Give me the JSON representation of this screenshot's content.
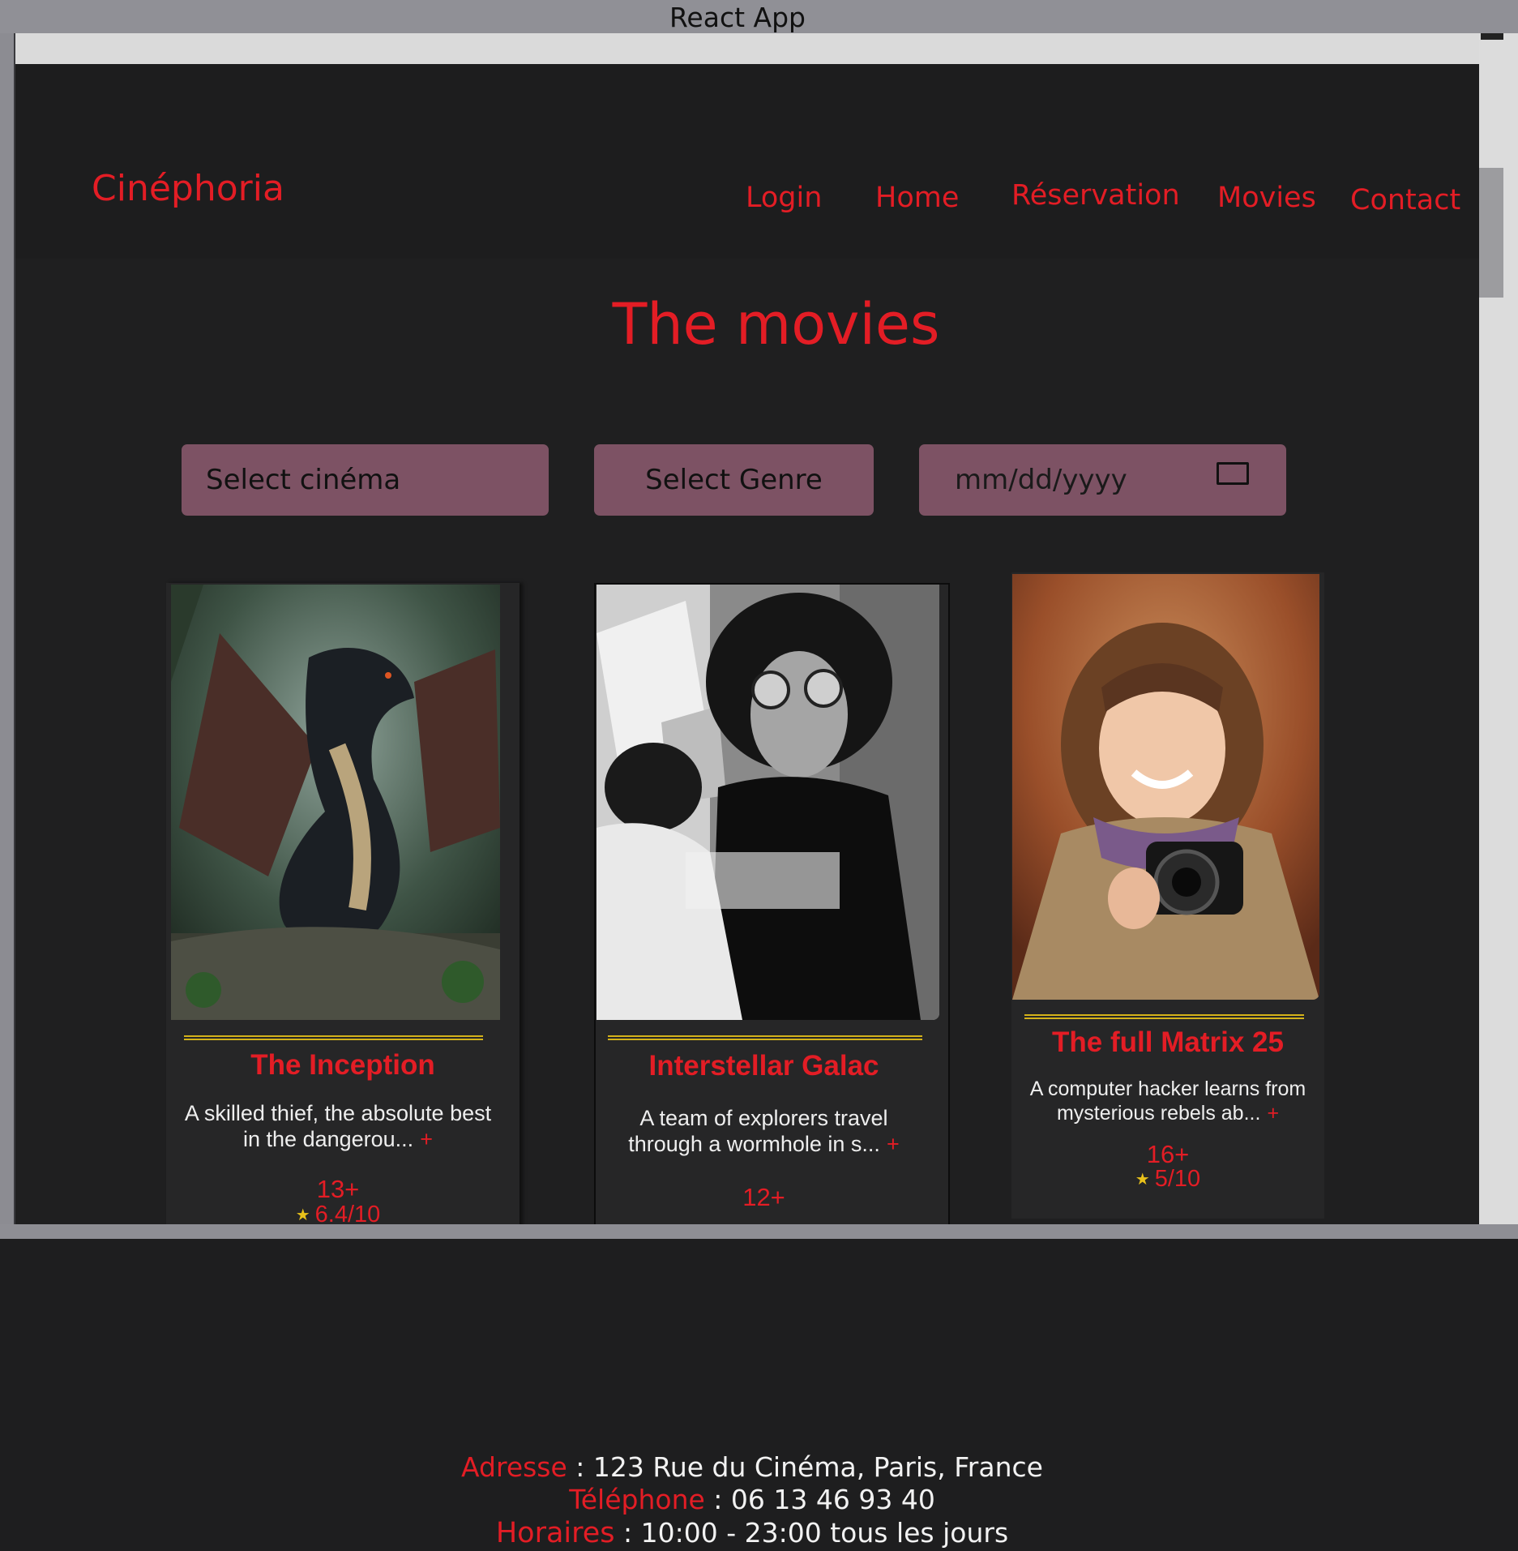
{
  "window": {
    "title": "React App"
  },
  "header": {
    "brand": "Cinéphoria",
    "nav": [
      {
        "label": "Login"
      },
      {
        "label": "Home"
      },
      {
        "label": "Réservation"
      },
      {
        "label": "Movies"
      },
      {
        "label": "Contact"
      }
    ]
  },
  "page": {
    "title": "The movies"
  },
  "filters": {
    "cinema": "Select  cinéma",
    "genre": "Select  Genre",
    "date_placeholder": "mm/dd/yyyy"
  },
  "movies": [
    {
      "title": "The Inception",
      "desc_line1": "A skilled thief, the absolute best",
      "desc_line2": "in the dangerou...",
      "more": "+",
      "age": "13+",
      "rating": "6.4/10"
    },
    {
      "title": "Interstellar Galac",
      "desc_line1": "A team of explorers travel",
      "desc_line2": "through a wormhole in s...",
      "more": "+",
      "age": "12+",
      "rating": ""
    },
    {
      "title": "The full Matrix 25",
      "desc_line1": "A computer hacker learns from",
      "desc_line2": "mysterious rebels ab...",
      "more": "+",
      "age": "16+",
      "rating": "5/10"
    }
  ],
  "footer": {
    "address_label": "Adresse",
    "address": " : 123 Rue du Cinéma, Paris, France",
    "phone_label": "Téléphone",
    "phone": " : 06 13 46 93 40",
    "hours_label": "Horaires",
    "hours": " : 10:00 - 23:00 tous les jours"
  },
  "colors": {
    "accent": "#e31d25",
    "background": "#1e1e1f",
    "filter": "#7d5264",
    "gold": "#d4b21a"
  }
}
